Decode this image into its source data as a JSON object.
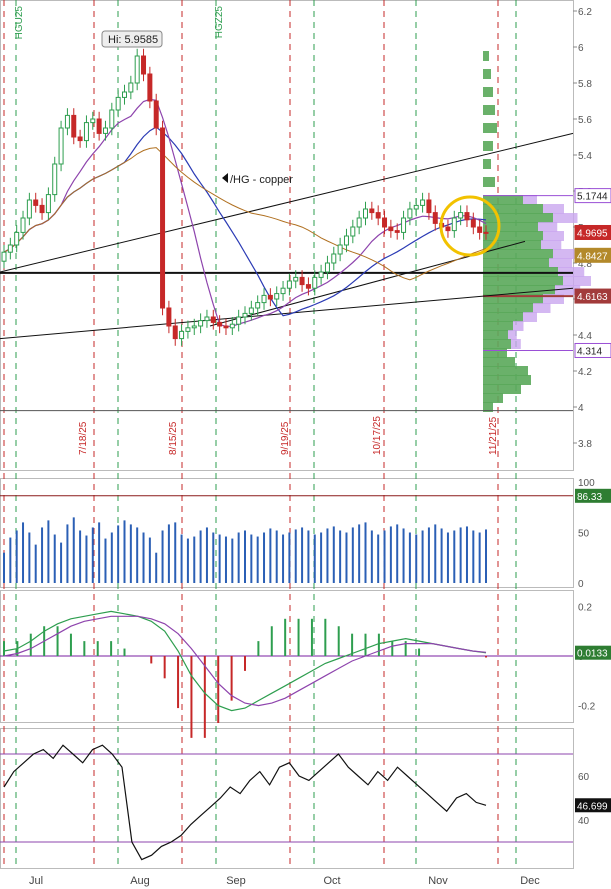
{
  "price": {
    "annotation_hi": "Hi: 5.9585",
    "symbol_label": "/HG - copper",
    "y_axis": {
      "min": 3.65,
      "max": 6.25,
      "ticks": [
        "6.2",
        "6",
        "5.8",
        "5.6",
        "5.4",
        "5.2",
        "5",
        "4.8",
        "4.6",
        "4.4",
        "4.2",
        "4",
        "3.8"
      ]
    },
    "value_tags": [
      {
        "text": "5.1744",
        "value": 5.1744,
        "bg": "#ffffff",
        "fg": "#222222",
        "border": "#9a4fd6"
      },
      {
        "text": "4.9695",
        "value": 4.9695,
        "bg": "#c62828",
        "fg": "#ffffff",
        "border": "#c62828"
      },
      {
        "text": "4.8427",
        "value": 4.8427,
        "bg": "#b3892a",
        "fg": "#ffffff",
        "border": "#b3892a"
      },
      {
        "text": "4.6163",
        "value": 4.6163,
        "bg": "#a23b3b",
        "fg": "#ffffff",
        "border": "#a23b3b"
      },
      {
        "text": "4.314",
        "value": 4.314,
        "bg": "#ffffff",
        "fg": "#222222",
        "border": "#9a4fd6"
      }
    ],
    "vertical_labels": [
      {
        "text": "HGU25",
        "color": "#2e9e4f"
      },
      {
        "text": "HGZ25",
        "color": "#2e9e4f"
      },
      {
        "text": "7/18/25",
        "color": "#c62828"
      },
      {
        "text": "8/15/25",
        "color": "#c62828"
      },
      {
        "text": "9/19/25",
        "color": "#c62828"
      },
      {
        "text": "10/17/25",
        "color": "#c62828"
      },
      {
        "text": "11/21/25",
        "color": "#c62828"
      }
    ]
  },
  "volume_panel": {
    "y_ticks": [
      "100",
      "50",
      "0"
    ],
    "value_tag": {
      "text": "86.33",
      "bg": "#2e7d32",
      "fg": "#ffffff"
    }
  },
  "macd_panel": {
    "y_ticks": [
      "0.2",
      "0",
      "-0.2"
    ],
    "value_tag": {
      "text": "0.0133",
      "bg": "#2e7d32",
      "fg": "#ffffff"
    }
  },
  "rsi_panel": {
    "y_ticks": [
      "60",
      "40"
    ],
    "value_tag": {
      "text": "46.699",
      "bg": "#111111",
      "fg": "#ffffff"
    }
  },
  "x_axis": {
    "labels": [
      "Jul",
      "Aug",
      "Sep",
      "Oct",
      "Nov",
      "Dec"
    ]
  },
  "colors": {
    "up": "#2e9e4f",
    "down": "#c62828",
    "ma_blue": "#2b3bb5",
    "ma_purple": "#8e44ad",
    "ma_orange": "#b07020",
    "circle": "#f2c200",
    "profile_green": "#5aa85a",
    "profile_purple": "#c9a6ef"
  },
  "chart_data": [
    {
      "type": "candlestick",
      "title": "",
      "series": [
        {
          "name": "/HG - copper",
          "close": [
            4.86,
            4.9,
            4.97,
            5.05,
            5.15,
            5.12,
            5.08,
            5.18,
            5.35,
            5.55,
            5.62,
            5.5,
            5.48,
            5.58,
            5.6,
            5.52,
            5.55,
            5.65,
            5.72,
            5.75,
            5.8,
            5.95,
            5.85,
            5.7,
            5.55,
            4.55,
            4.45,
            4.38,
            4.42,
            4.44,
            4.45,
            4.48,
            4.5,
            4.47,
            4.45,
            4.44,
            4.46,
            4.5,
            4.52,
            4.55,
            4.58,
            4.62,
            4.6,
            4.63,
            4.66,
            4.7,
            4.72,
            4.68,
            4.66,
            4.72,
            4.75,
            4.8,
            4.85,
            4.9,
            4.95,
            5.0,
            5.05,
            5.1,
            5.08,
            5.05,
            5.0,
            4.98,
            4.97,
            5.05,
            5.1,
            5.12,
            5.15,
            5.08,
            5.02,
            5.0,
            4.98,
            5.05,
            5.08,
            5.04,
            5.0,
            4.97,
            4.9695
          ]
        }
      ],
      "y_range": [
        3.65,
        6.25
      ],
      "x_labels": [
        "Jul",
        "Aug",
        "Sep",
        "Oct",
        "Nov",
        "Dec"
      ]
    },
    {
      "type": "bar",
      "title": "",
      "series": [
        {
          "name": "volume",
          "values": [
            30,
            45,
            52,
            60,
            50,
            38,
            55,
            62,
            48,
            40,
            58,
            65,
            52,
            47,
            55,
            60,
            44,
            50,
            57,
            62,
            58,
            55,
            50,
            45,
            30,
            52,
            58,
            60,
            48,
            44,
            46,
            52,
            55,
            50,
            48,
            46,
            44,
            50,
            52,
            48,
            46,
            50,
            54,
            52,
            48,
            50,
            53,
            55,
            52,
            48,
            50,
            54,
            56,
            52,
            50,
            55,
            58,
            60,
            52,
            48,
            52,
            56,
            58,
            54,
            50,
            48,
            52,
            55,
            58,
            54,
            50,
            52,
            55,
            56,
            52,
            50,
            53
          ]
        }
      ],
      "y_range": [
        0,
        100
      ]
    },
    {
      "type": "line",
      "title": "",
      "series": [
        {
          "name": "macd",
          "values": [
            0.02,
            0.03,
            0.06,
            0.1,
            0.13,
            0.15,
            0.16,
            0.17,
            0.18,
            0.17,
            0.16,
            0.14,
            0.1,
            0.02,
            -0.08,
            -0.15,
            -0.2,
            -0.22,
            -0.21,
            -0.18,
            -0.15,
            -0.12,
            -0.09,
            -0.06,
            -0.03,
            -0.01,
            0.01,
            0.03,
            0.05,
            0.06,
            0.07,
            0.06,
            0.05,
            0.04,
            0.03,
            0.02,
            0.013
          ]
        },
        {
          "name": "signal",
          "values": [
            0.0,
            0.01,
            0.03,
            0.06,
            0.09,
            0.12,
            0.14,
            0.15,
            0.16,
            0.16,
            0.16,
            0.15,
            0.13,
            0.09,
            0.03,
            -0.04,
            -0.11,
            -0.16,
            -0.19,
            -0.2,
            -0.19,
            -0.17,
            -0.14,
            -0.11,
            -0.08,
            -0.05,
            -0.02,
            0.0,
            0.02,
            0.04,
            0.05,
            0.05,
            0.05,
            0.04,
            0.03,
            0.02,
            0.015
          ]
        }
      ],
      "y_range": [
        -0.25,
        0.25
      ]
    },
    {
      "type": "line",
      "title": "",
      "series": [
        {
          "name": "rsi",
          "values": [
            55,
            62,
            66,
            70,
            72,
            68,
            74,
            70,
            66,
            72,
            74,
            70,
            64,
            30,
            22,
            24,
            28,
            30,
            33,
            38,
            42,
            46,
            50,
            55,
            52,
            58,
            62,
            56,
            64,
            66,
            60,
            58,
            62,
            66,
            70,
            64,
            60,
            56,
            62,
            58,
            64,
            60,
            56,
            52,
            48,
            44,
            50,
            52,
            48,
            46.699
          ]
        }
      ],
      "y_range": [
        20,
        80
      ],
      "reference_lines": [
        70,
        30
      ]
    }
  ]
}
